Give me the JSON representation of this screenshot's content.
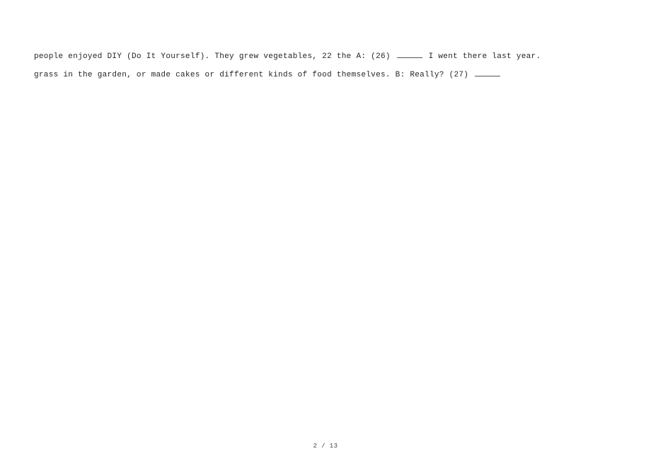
{
  "content": {
    "line1": {
      "seg1": "people enjoyed DIY (Do It Yourself). They grew vegetables, 22 the A: (26) ",
      "seg2": " I went there last year."
    },
    "line2": {
      "seg1": "grass in the garden, or made cakes or different kinds of food themselves. B: Really? (27) "
    }
  },
  "footer": {
    "page_number": "2 / 13"
  }
}
